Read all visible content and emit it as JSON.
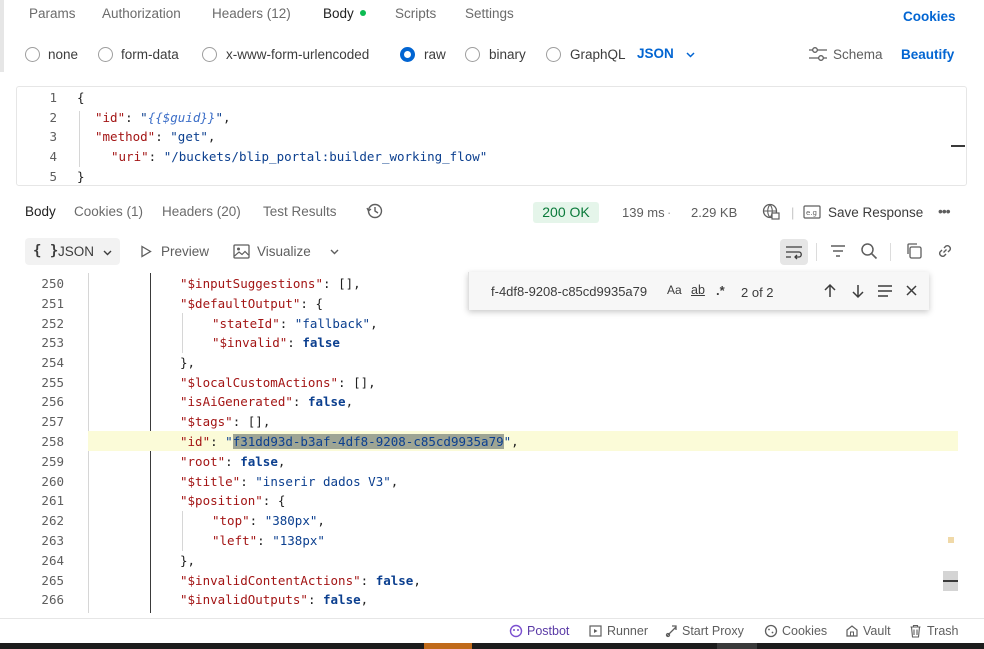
{
  "request_tabs": {
    "params": "Params",
    "authorization": "Authorization",
    "headers": "Headers (12)",
    "body": "Body",
    "scripts": "Scripts",
    "settings": "Settings",
    "cookies": "Cookies"
  },
  "body_types": {
    "none": "none",
    "form_data": "form-data",
    "urlencoded": "x-www-form-urlencoded",
    "raw": "raw",
    "binary": "binary",
    "graphql": "GraphQL",
    "format": "JSON",
    "schema": "Schema",
    "beautify": "Beautify"
  },
  "request_body": {
    "line_numbers": [
      "1",
      "2",
      "3",
      "4",
      "5"
    ],
    "lines": [
      {
        "open": "{"
      },
      {
        "key": "\"id\"",
        "sep": ": ",
        "q1": "\"",
        "var": "{{$guid}}",
        "q2": "\"",
        "end": ","
      },
      {
        "key": "\"method\"",
        "sep": ": ",
        "str": "\"get\"",
        "end": ","
      },
      {
        "key": "\"uri\"",
        "sep": ": ",
        "str": "\"/buckets/blip_portal:builder_working_flow\""
      },
      {
        "close": "}"
      }
    ]
  },
  "response_tabs": {
    "body": "Body",
    "cookies": "Cookies (1)",
    "headers": "Headers (20)",
    "test_results": "Test Results",
    "status": "200 OK",
    "time": "139 ms",
    "size": "2.29 KB",
    "save": "Save Response"
  },
  "response_toolbar": {
    "format_icon": "{ }",
    "format": "JSON",
    "preview": "Preview",
    "visualize": "Visualize"
  },
  "find_widget": {
    "query": "f-4df8-9208-c85cd9935a79",
    "match_case": "Aa",
    "whole_word": "ab",
    "regex": ".*",
    "count": "2 of 2"
  },
  "response_body": [
    {
      "n": "250",
      "k": "\"$inputSuggestions\"",
      "v": "[]",
      "e": ","
    },
    {
      "n": "251",
      "k": "\"$defaultOutput\"",
      "v": "{",
      "e": ""
    },
    {
      "n": "252",
      "k": "\"stateId\"",
      "v": "\"fallback\"",
      "e": ","
    },
    {
      "n": "253",
      "k": "\"$invalid\"",
      "v": "false",
      "e": ""
    },
    {
      "n": "254",
      "close": "},"
    },
    {
      "n": "255",
      "k": "\"$localCustomActions\"",
      "v": "[]",
      "e": ","
    },
    {
      "n": "256",
      "k": "\"isAiGenerated\"",
      "v": "false",
      "e": ","
    },
    {
      "n": "257",
      "k": "\"$tags\"",
      "v": "[]",
      "e": ","
    },
    {
      "n": "258",
      "k": "\"id\"",
      "v": "f31dd93d-b3af-4df8-9208-c85cd9935a79",
      "e": ","
    },
    {
      "n": "259",
      "k": "\"root\"",
      "v": "false",
      "e": ","
    },
    {
      "n": "260",
      "k": "\"$title\"",
      "v": "\"inserir dados V3\"",
      "e": ","
    },
    {
      "n": "261",
      "k": "\"$position\"",
      "v": "{",
      "e": ""
    },
    {
      "n": "262",
      "k": "\"top\"",
      "v": "\"380px\"",
      "e": ","
    },
    {
      "n": "263",
      "k": "\"left\"",
      "v": "\"138px\"",
      "e": ""
    },
    {
      "n": "264",
      "close": "},"
    },
    {
      "n": "265",
      "k": "\"$invalidContentActions\"",
      "v": "false",
      "e": ","
    },
    {
      "n": "266",
      "k": "\"$invalidOutputs\"",
      "v": "false",
      "e": ","
    }
  ],
  "status_bar": {
    "postbot": "Postbot",
    "runner": "Runner",
    "start_proxy": "Start Proxy",
    "cookies": "Cookies",
    "vault": "Vault",
    "trash": "Trash"
  },
  "colors": {
    "accent_blue": "#0265d2",
    "status_green": "#0cbb52",
    "highlight_line": "#fbfbd8",
    "match_bg": "#9ea594"
  }
}
